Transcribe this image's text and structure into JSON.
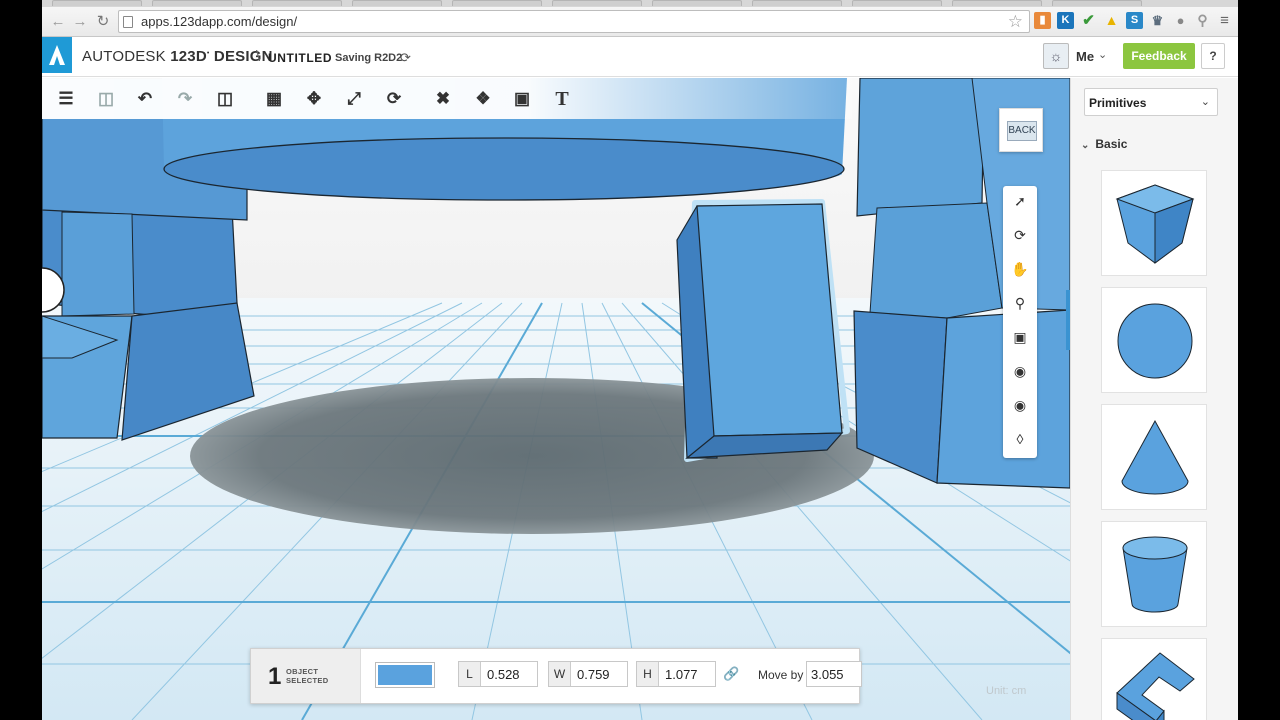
{
  "browser": {
    "url": "apps.123dapp.com/design/",
    "extensions": [
      "chart-icon",
      "K",
      "check-icon",
      "drive-icon",
      "S",
      "stamp-icon",
      "bulb-icon",
      "pin-icon"
    ]
  },
  "app": {
    "brand_prefix": "AUTODESK",
    "brand_product": "123D",
    "brand_suffix": "DESIGN",
    "separator": "\\",
    "doc_title": "UNTITLED",
    "save_status": "Saving R2D2",
    "user_label": "Me",
    "feedback_label": "Feedback",
    "help_label": "?"
  },
  "toolbar": {
    "tools": [
      "menu-icon",
      "save-icon",
      "undo-icon",
      "redo-icon",
      "clipboard-icon",
      "transform-icon",
      "move-icon",
      "scale-icon",
      "refresh-icon",
      "construct-icon",
      "modify-icon",
      "group-icon",
      "text-icon"
    ],
    "text_tool_label": "T"
  },
  "viewcube": {
    "label": "BACK"
  },
  "navigation": [
    "select-icon",
    "orbit-icon",
    "pan-icon",
    "zoom-icon",
    "fit-icon",
    "zoom-selected-icon",
    "visibility-icon",
    "material-icon"
  ],
  "selection": {
    "count": "1",
    "line1": "OBJECT",
    "line2": "SELECTED",
    "color": "#5aa2de",
    "dims": [
      {
        "key": "L",
        "value": "0.528"
      },
      {
        "key": "W",
        "value": "0.759"
      },
      {
        "key": "H",
        "value": "1.077"
      }
    ],
    "move_label": "Move by",
    "move_value": "3.055"
  },
  "unit": "Unit:  cm",
  "sidebar": {
    "dropdown": "Primitives",
    "section": "Basic",
    "items": [
      "box",
      "sphere",
      "cone",
      "cylinder",
      "torus"
    ]
  },
  "colors": {
    "accent": "#1f9ad6",
    "model": "#5aa2de",
    "feedback": "#8cc63f",
    "grid": "#8fc3e0"
  }
}
